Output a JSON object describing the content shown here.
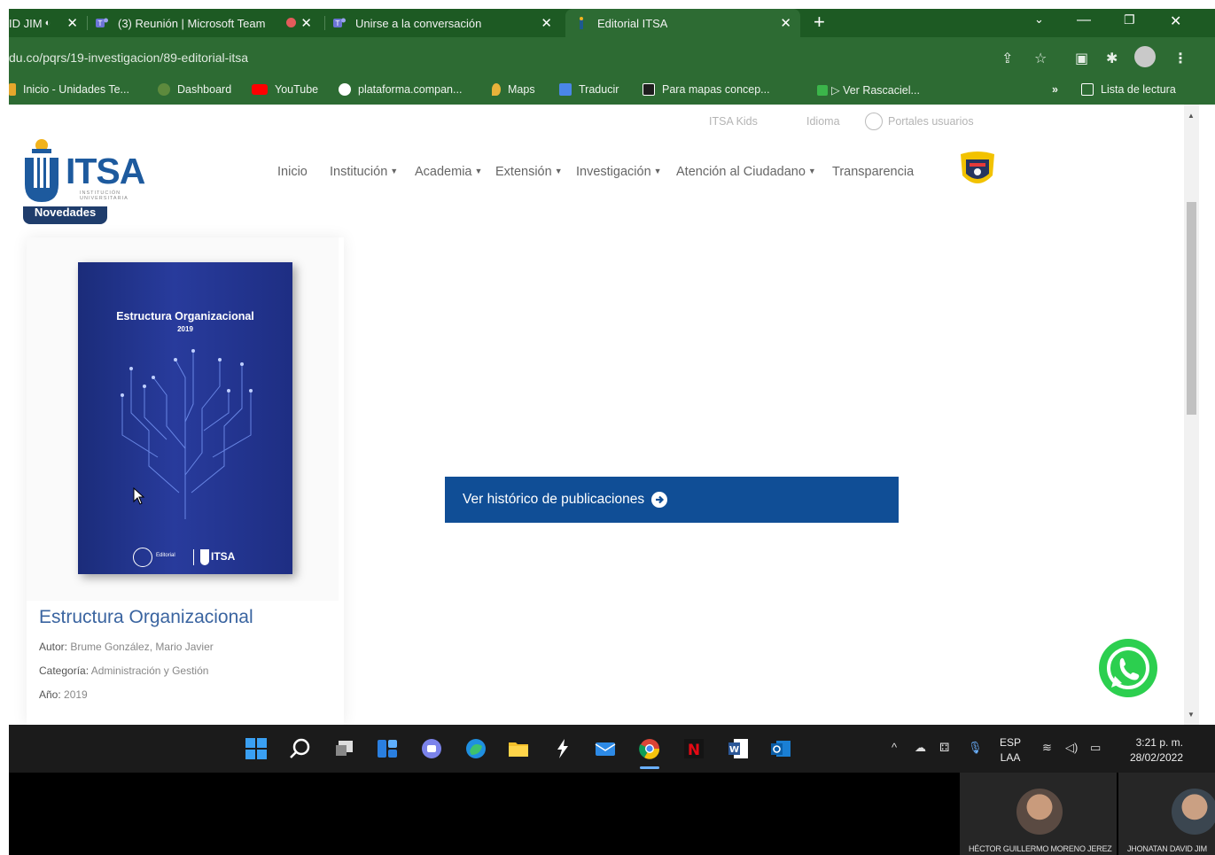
{
  "browser": {
    "tabs": [
      {
        "label": "ID JIM",
        "active": false
      },
      {
        "label": "(3) Reunión | Microsoft Team",
        "active": false
      },
      {
        "label": "Unirse a la conversación",
        "active": false
      },
      {
        "label": "Editorial ITSA",
        "active": true
      }
    ],
    "new_tab": "+",
    "url": "du.co/pqrs/19-investigacion/89-editorial-itsa",
    "bookmarks": [
      {
        "label": "Inicio - Unidades Te..."
      },
      {
        "label": "Dashboard"
      },
      {
        "label": "YouTube"
      },
      {
        "label": "plataforma.compan..."
      },
      {
        "label": "Maps"
      },
      {
        "label": "Traducir"
      },
      {
        "label": "Para mapas concep..."
      },
      {
        "label": "▷ Ver Rascaciel..."
      }
    ],
    "more_bookmarks": "»",
    "reading_list": "Lista de lectura",
    "colors": {
      "tabbar": "#1d5a23",
      "toolbar": "#2d6b33"
    }
  },
  "site": {
    "top_links": [
      "ITSA Kids",
      "Idioma",
      "Portales usuarios"
    ],
    "logo_text": "ITSA",
    "logo_subtext": "INSTITUCIÓN UNIVERSITARIA",
    "nav": [
      {
        "label": "Inicio",
        "dropdown": false
      },
      {
        "label": "Institución",
        "dropdown": true
      },
      {
        "label": "Academia",
        "dropdown": true
      },
      {
        "label": "Extensión",
        "dropdown": true
      },
      {
        "label": "Investigación",
        "dropdown": true
      },
      {
        "label": "Atención al Ciudadano",
        "dropdown": true
      },
      {
        "label": "Transparencia",
        "dropdown": false
      }
    ],
    "section_badge": "Novedades",
    "book": {
      "cover_title": "Estructura Organizacional",
      "cover_year": "2019",
      "cover_publisher": "Editorial",
      "cover_logo": "ITSA",
      "title": "Estructura Organizacional",
      "author_label": "Autor:",
      "author": "Brume González, Mario Javier",
      "category_label": "Categoría:",
      "category": "Administración y Gestión",
      "year_label": "Año:",
      "year": "2019"
    },
    "history_button": "Ver histórico de publicaciones",
    "colors": {
      "primary": "#104e96",
      "link": "#3a64a0",
      "badge": "#1f3d6c",
      "whatsapp": "#2ccf4f"
    }
  },
  "taskbar": {
    "lang_top": "ESP",
    "lang_bottom": "LAA",
    "time": "3:21 p. m.",
    "date": "28/02/2022"
  },
  "call": {
    "participants": [
      {
        "name": "HÉCTOR GUILLERMO MORENO JEREZ"
      },
      {
        "name": "JHONATAN DAVID JIM"
      }
    ]
  }
}
